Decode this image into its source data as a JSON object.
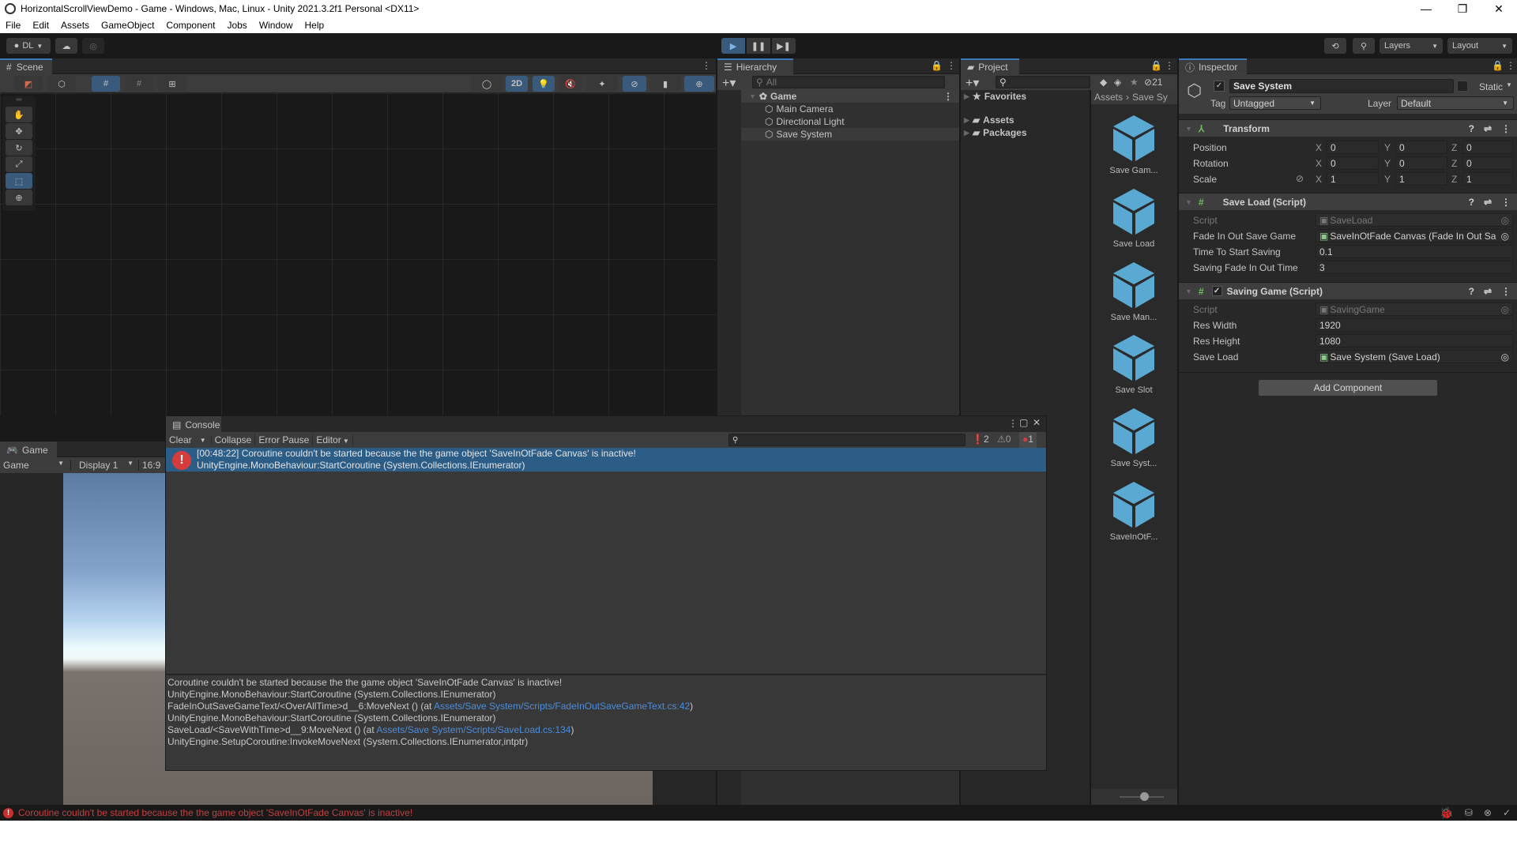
{
  "window": {
    "title": "HorizontalScrollViewDemo - Game - Windows, Mac, Linux - Unity 2021.3.2f1 Personal <DX11>",
    "controls": [
      "—",
      "❐",
      "✕"
    ]
  },
  "menu": [
    "File",
    "Edit",
    "Assets",
    "GameObject",
    "Component",
    "Jobs",
    "Window",
    "Help"
  ],
  "toolbar": {
    "account": "DL",
    "layers": "Layers",
    "layout": "Layout",
    "play_state": "playing"
  },
  "scene": {
    "tab": "Scene",
    "mode_2d": "2D"
  },
  "game": {
    "tab": "Game",
    "view_select": "Game",
    "display_select": "Display 1",
    "aspect": "16:9"
  },
  "hierarchy": {
    "tab": "Hierarchy",
    "search_placeholder": "All",
    "scene_name": "Game",
    "items": [
      "Main Camera",
      "Directional Light",
      "Save System"
    ],
    "selected": "Save System"
  },
  "project": {
    "tab": "Project",
    "hidden_count": "21",
    "tree": {
      "favorites": "Favorites",
      "assets": "Assets",
      "packages": "Packages"
    },
    "breadcrumb": [
      "Assets",
      "Save Sy"
    ],
    "assets": [
      "Save Gam...",
      "Save Load",
      "Save Man...",
      "Save Slot",
      "Save Syst...",
      "SaveInOtF..."
    ]
  },
  "inspector": {
    "tab": "Inspector",
    "object_name": "Save System",
    "static_label": "Static",
    "tag_label": "Tag",
    "tag_value": "Untagged",
    "layer_label": "Layer",
    "layer_value": "Default",
    "transform": {
      "title": "Transform",
      "position": {
        "label": "Position",
        "x": "0",
        "y": "0",
        "z": "0"
      },
      "rotation": {
        "label": "Rotation",
        "x": "0",
        "y": "0",
        "z": "0"
      },
      "scale": {
        "label": "Scale",
        "x": "1",
        "y": "1",
        "z": "1"
      }
    },
    "save_load": {
      "title": "Save Load (Script)",
      "script_label": "Script",
      "script_value": "SaveLoad",
      "fields": [
        {
          "label": "Fade In Out Save Game",
          "value": "SaveInOtFade Canvas (Fade In Out Sa"
        },
        {
          "label": "Time To Start Saving",
          "value": "0.1"
        },
        {
          "label": "Saving Fade In Out Time",
          "value": "3"
        }
      ]
    },
    "saving_game": {
      "title": "Saving Game (Script)",
      "script_label": "Script",
      "script_value": "SavingGame",
      "fields": [
        {
          "label": "Res Width",
          "value": "1920"
        },
        {
          "label": "Res Height",
          "value": "1080"
        },
        {
          "label": "Save Load",
          "value": "Save System (Save Load)"
        }
      ]
    },
    "add_component": "Add Component"
  },
  "console": {
    "tab": "Console",
    "buttons": {
      "clear": "Clear",
      "collapse": "Collapse",
      "error_pause": "Error Pause",
      "editor": "Editor"
    },
    "counts": {
      "info": "2",
      "warn": "0",
      "error": "1"
    },
    "entry": {
      "line1": "[00:48:22] Coroutine couldn't be started because the the game object 'SaveInOtFade Canvas' is inactive!",
      "line2": "UnityEngine.MonoBehaviour:StartCoroutine (System.Collections.IEnumerator)"
    },
    "detail": [
      {
        "text": "Coroutine couldn't be started because the the game object 'SaveInOtFade Canvas' is inactive!",
        "link": "",
        "suffix": ""
      },
      {
        "text": "UnityEngine.MonoBehaviour:StartCoroutine (System.Collections.IEnumerator)",
        "link": "",
        "suffix": ""
      },
      {
        "text": "FadeInOutSaveGameText/<OverAllTime>d__6:MoveNext () (at ",
        "link": "Assets/Save System/Scripts/FadeInOutSaveGameText.cs:42",
        "suffix": ")"
      },
      {
        "text": "UnityEngine.MonoBehaviour:StartCoroutine (System.Collections.IEnumerator)",
        "link": "",
        "suffix": ""
      },
      {
        "text": "SaveLoad/<SaveWithTime>d__9:MoveNext () (at ",
        "link": "Assets/Save System/Scripts/SaveLoad.cs:134",
        "suffix": ")"
      },
      {
        "text": "UnityEngine.SetupCoroutine:InvokeMoveNext (System.Collections.IEnumerator,intptr)",
        "link": "",
        "suffix": ""
      }
    ]
  },
  "statusbar": {
    "message": "Coroutine couldn't be started because the the game object 'SaveInOtFade Canvas' is inactive!"
  },
  "colors": {
    "accent": "#3a79bb",
    "selection": "#2c5d87",
    "error": "#d63c3c",
    "link": "#4c8ddd",
    "asset_cube": "#5aa9d3"
  }
}
